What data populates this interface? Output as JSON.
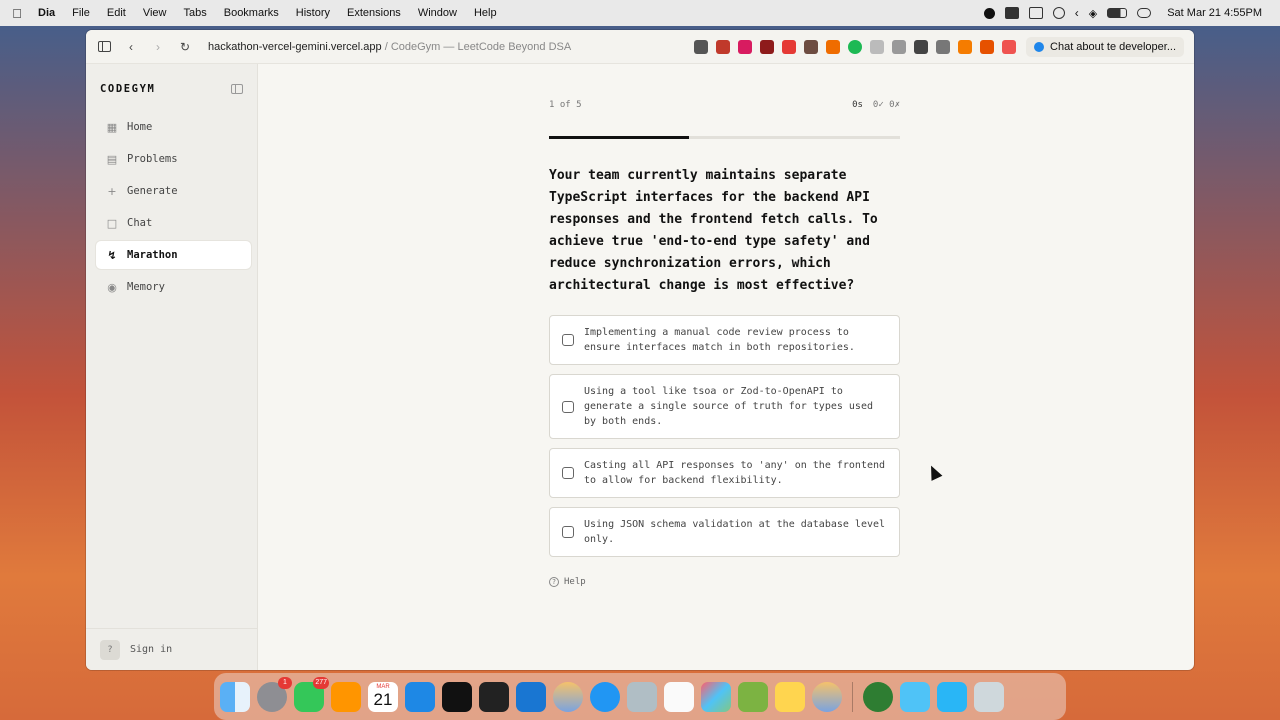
{
  "menubar": {
    "app_name": "Dia",
    "items": [
      "File",
      "Edit",
      "View",
      "Tabs",
      "Bookmarks",
      "History",
      "Extensions",
      "Window",
      "Help"
    ],
    "clock": "Sat Mar 21  4:55PM"
  },
  "browser": {
    "url_host": "hackathon-vercel-gemini.vercel.app",
    "url_sep": " / ",
    "page_title": "CodeGym — LeetCode Beyond DSA",
    "chat_pill": "Chat about te developer..."
  },
  "sidebar": {
    "brand": "CODEGYM",
    "items": [
      {
        "label": "Home",
        "icon": "grid-icon"
      },
      {
        "label": "Problems",
        "icon": "clipboard-icon"
      },
      {
        "label": "Generate",
        "icon": "plus-icon"
      },
      {
        "label": "Chat",
        "icon": "chat-bubble-icon"
      },
      {
        "label": "Marathon",
        "icon": "lightning-icon",
        "active": true
      },
      {
        "label": "Memory",
        "icon": "brain-icon"
      }
    ],
    "sign_in": "Sign in",
    "avatar_glyph": "?"
  },
  "quiz": {
    "counter": "1 of 5",
    "time": "0s",
    "score": "0✓ 0✗",
    "progress": 0.4,
    "question": "Your team currently maintains separate TypeScript interfaces for the backend API responses and the frontend fetch calls. To achieve true 'end-to-end type safety' and reduce synchronization errors, which architectural change is most effective?",
    "options": [
      "Implementing a manual code review process to ensure interfaces match in both repositories.",
      "Using a tool like tsoa or Zod-to-OpenAPI to generate a single source of truth for types used by both ends.",
      "Casting all API responses to 'any' on the frontend to allow for backend flexibility.",
      "Using JSON schema validation at the database level only."
    ],
    "help": "Help",
    "help_glyph": "?"
  },
  "dock": {
    "settings_badge": "1",
    "messages_badge": "277",
    "calendar_month": "MAR",
    "calendar_day": "21"
  }
}
